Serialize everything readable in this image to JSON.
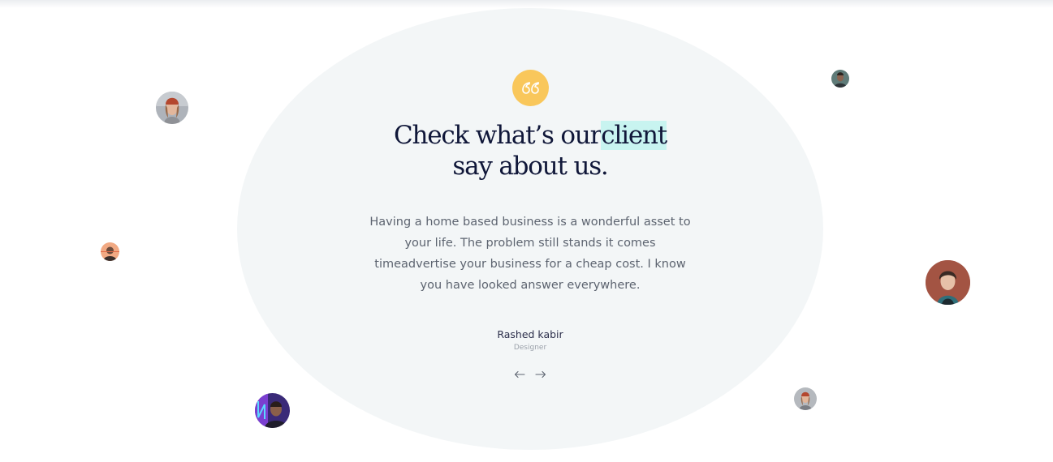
{
  "testimonial": {
    "quote_icon": "quote-66-icon",
    "quote_mark": "66",
    "headline_before": "Check what’s our",
    "headline_highlight": "client",
    "headline_after": "say about us.",
    "body": "Having a home based business is a wonderful asset to your life. The problem still stands it comes timeadvertise your business for a cheap cost. I know you have looked answer everywhere.",
    "author_name": "Rashed kabir",
    "author_role": "Designer",
    "prev_icon": "arrow-left-icon",
    "next_icon": "arrow-right-icon"
  },
  "colors": {
    "quote_badge": "#f9c75b",
    "highlight": "#c8f4f0",
    "ellipse_bg": "#f3f6f7",
    "heading": "#101739",
    "body_text": "#5d6470"
  },
  "avatars": [
    {
      "name": "client-avatar-1"
    },
    {
      "name": "client-avatar-2"
    },
    {
      "name": "client-avatar-3"
    },
    {
      "name": "client-avatar-4"
    },
    {
      "name": "client-avatar-5"
    },
    {
      "name": "client-avatar-6"
    },
    {
      "name": "client-avatar-7"
    }
  ]
}
